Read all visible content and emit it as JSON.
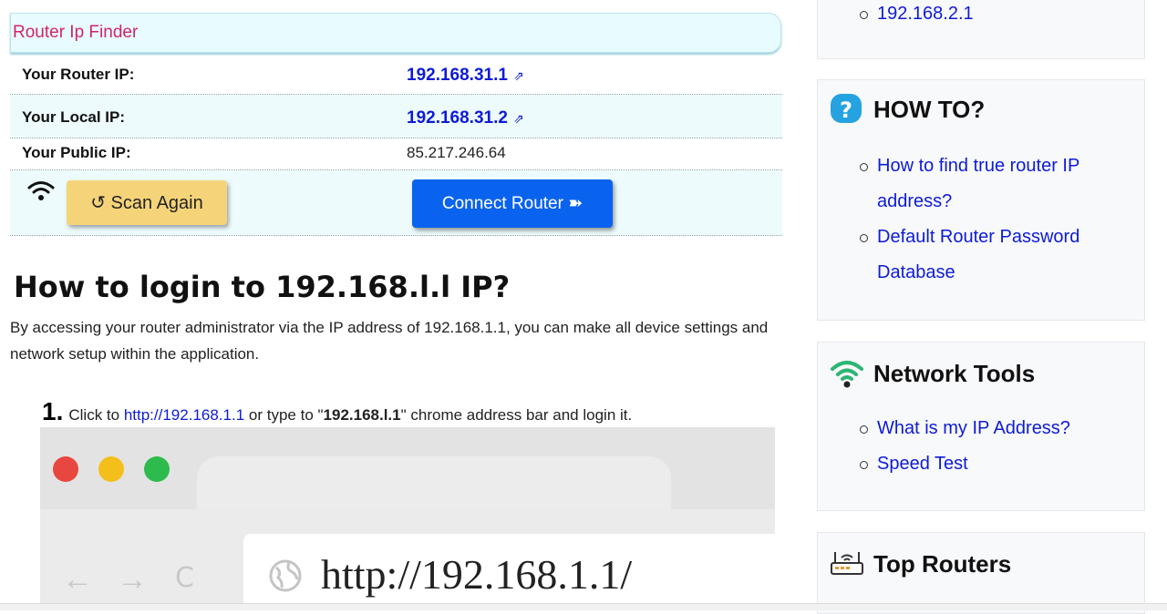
{
  "finder": {
    "title": "Router Ip Finder",
    "rows": [
      {
        "label": "Your Router IP:",
        "value": "192.168.31.1",
        "link_icon": "⇗"
      },
      {
        "label": "Your Local IP:",
        "value": "192.168.31.2",
        "link_icon": "⇗"
      },
      {
        "label": "Your Public IP:",
        "value": "85.217.246.64"
      }
    ],
    "scan_label": "↺ Scan Again",
    "connect_label": "Connect Router ➽"
  },
  "article": {
    "heading": "How to login to 192.168.l.l IP?",
    "intro": "By accessing your router administrator via the IP address of 192.168.1.1, you can make all device settings and network setup within the application.",
    "step": {
      "number": "1.",
      "prefix": "Click to ",
      "link": "http://192.168.1.1",
      "middle": " or type to \"",
      "bold": "192.168.l.1",
      "suffix": "\" chrome address bar and login it."
    },
    "browser_image": {
      "url_text": "http://192.168.1.1/",
      "nav_back": "←",
      "nav_forward": "→",
      "nav_reload": "C"
    }
  },
  "sidebar": {
    "top_item": "192.168.2.1",
    "howto": {
      "title": "HOW TO?",
      "items": [
        "How to find true router IP",
        "address?",
        "Default Router Password",
        "Database"
      ]
    },
    "network_tools": {
      "title": "Network Tools",
      "items": [
        "What is my IP Address?",
        "Speed Test"
      ]
    },
    "top_routers": {
      "title": "Top Routers"
    }
  },
  "colors": {
    "link": "#0d1bd6",
    "finder_title": "#d1246b",
    "scan_button": "#f5d479",
    "connect_button": "#0a63ee",
    "underline": "#e3242b"
  },
  "icons": [
    "external-link-icon",
    "wifi-icon",
    "question-icon",
    "router-icon",
    "globe-icon"
  ]
}
